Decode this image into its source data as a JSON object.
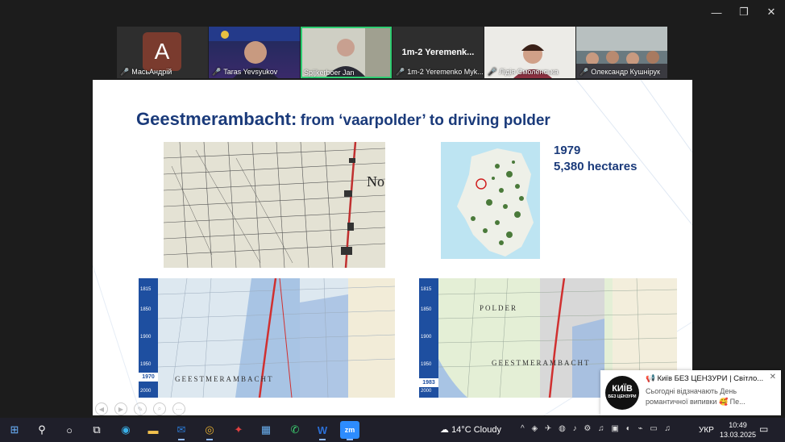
{
  "window": {
    "minimize": "—",
    "restore": "❐",
    "close": "✕"
  },
  "participants": [
    {
      "name": "МасьАндрій",
      "type": "avatar",
      "initial": "A"
    },
    {
      "name": "Taras Yevsyukov",
      "type": "video"
    },
    {
      "name": "Spijkerboer Jan",
      "type": "video",
      "active": true
    },
    {
      "name": "1m-2 Yeremenko Myk...",
      "type": "name",
      "display": "1m-2 Yeremenk..."
    },
    {
      "name": "Лідія Смоленська",
      "type": "video"
    },
    {
      "name": "Олександр Кушнірук",
      "type": "video"
    }
  ],
  "slide": {
    "title_main": "Geestmerambacht:",
    "title_sub": "from ‘vaarpolder’ to driving polder",
    "year": "1979",
    "area": "5,380 hectares",
    "map_left_label": "GEESTMERAMBACHT",
    "map_left_year": "1970",
    "map_right_year": "1983",
    "map_right_label": "GEESTMERAMBACHT",
    "map_right_polder": "POLDER",
    "timeline_ticks": [
      "1815",
      "1850",
      "1900",
      "1950",
      "2000"
    ]
  },
  "notification": {
    "title": "📢 Київ БЕЗ ЦЕНЗУРИ | Світло...",
    "body": "Сьогодні відзначають День романтичної випивки 🥰 Пе...",
    "logo_main": "КИЇВ",
    "logo_sub": "БЕЗ ЦЕНЗУРИ",
    "close": "✕"
  },
  "taskbar": {
    "weather": "14°C  Cloudy",
    "language": "УКР",
    "time": "10:49",
    "date": "13.03.2025",
    "icons": [
      "windows-icon",
      "search-icon",
      "cortana-icon",
      "task-view-icon",
      "edge-icon",
      "file-explorer-icon",
      "outlook-icon",
      "chrome-icon",
      "photos-icon",
      "store-icon",
      "whatsapp-icon",
      "word-icon",
      "zoom-icon"
    ]
  },
  "colors": {
    "accent": "#1a3a7a",
    "active_tile": "#2ecc71",
    "taskbar": "#1f1f2a",
    "timeline": "#1e4fa0"
  }
}
